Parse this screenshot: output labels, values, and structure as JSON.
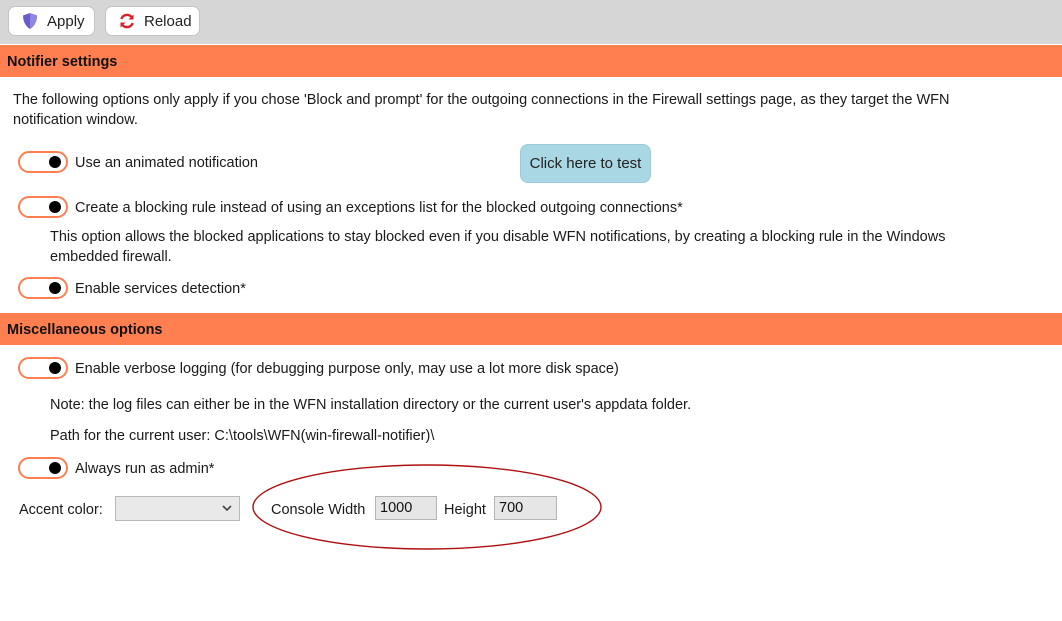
{
  "toolbar": {
    "apply_label": "Apply",
    "reload_label": "Reload",
    "apply_icon": "shield-icon",
    "reload_icon": "refresh-icon"
  },
  "notifier": {
    "header": "Notifier settings",
    "intro": "The following options only apply if you chose 'Block and prompt' for the outgoing connections in the Firewall settings page, as they target the WFN notification window.",
    "animated_label": "Use an animated notification",
    "test_button": "Click here to test",
    "blocking_rule_label": "Create a blocking rule instead of using an exceptions list for the blocked outgoing connections*",
    "blocking_rule_desc": "This option allows the blocked applications to stay blocked even if you disable WFN notifications, by creating a blocking rule in the Windows embedded firewall.",
    "services_label": "Enable services detection*"
  },
  "misc": {
    "header": "Miscellaneous options",
    "verbose_label": "Enable verbose logging (for debugging purpose only, may use a lot more disk space)",
    "log_note": "Note: the log files can either be in the WFN installation directory or the current user's appdata folder.",
    "path_text": "Path for the current user: C:\\tools\\WFN(win-firewall-notifier)\\",
    "admin_label": "Always run as admin*",
    "accent_label": "Accent color:",
    "accent_value": "",
    "console_width_label": "Console Width",
    "console_width_value": "1000",
    "height_label": "Height",
    "height_value": "700"
  },
  "colors": {
    "accent": "#ff7f50",
    "toolbar_bg": "#d6d6d6",
    "test_button_bg": "#a9d7e4",
    "annotation": "#b01010"
  },
  "toggles": {
    "animated": true,
    "blocking_rule": true,
    "services": true,
    "verbose": true,
    "admin": true
  }
}
